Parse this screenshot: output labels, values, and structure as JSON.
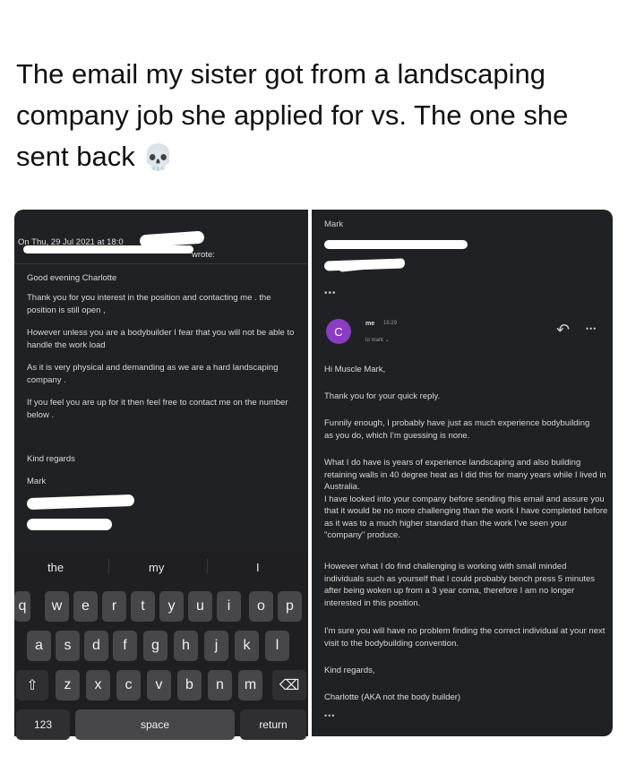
{
  "caption": {
    "text": "The email my sister got from a landscaping company job she applied for vs. The one she sent back",
    "emoji": "💀"
  },
  "left_email": {
    "header_date": "On Thu, 29 Jul 2021 at 18:0",
    "header_wrote": "wrote:",
    "greeting": "Good evening Charlotte",
    "paragraphs": [
      "Thank you for you interest in the position and contacting me . the position is still open ,",
      "However unless you are a bodybuilder I fear that you will not be able to handle the work load",
      "As it is very physical and demanding as we are a hard landscaping company .",
      "If you feel you are up for it then feel free to contact me on the number below ."
    ],
    "signoff": "Kind regards",
    "name": "Mark"
  },
  "keyboard": {
    "suggestions": [
      "the",
      "my",
      "I"
    ],
    "row1": [
      "q",
      "w",
      "e",
      "r",
      "t",
      "y",
      "u",
      "i",
      "o",
      "p"
    ],
    "row2": [
      "a",
      "s",
      "d",
      "f",
      "g",
      "h",
      "j",
      "k",
      "l"
    ],
    "row3": [
      "z",
      "x",
      "c",
      "v",
      "b",
      "n",
      "m"
    ],
    "shift_icon": "⇧",
    "delete_icon": "⌫",
    "numbers_key": "123",
    "space_key": "space",
    "return_key": "return"
  },
  "right_email": {
    "quoted_name": "Mark",
    "collapsed_dots": "•••",
    "avatar_letter": "C",
    "sender": "me",
    "time": "16:29",
    "to_line": "to mark ⌄",
    "reply_icon": "↶",
    "more_icon": "•••",
    "greeting": "Hi Muscle Mark,",
    "paragraphs": [
      "Thank you for your quick reply.",
      "Funnily enough, I probably have just as much experience bodybuilding as you do, which I'm guessing is none.",
      "What I do have is years of experience landscaping and also building retaining walls in 40 degree heat as I did this for many years while I lived in Australia.\nI have looked into your company before sending this email and assure you that it would be no more challenging than the work I have completed before as it was to a much higher standard than the work I've seen your \"company\" produce.",
      "However what I do find challenging is working with small minded individuals such as yourself that I could probably bench press 5 minutes after being woken up from a 3 year coma, therefore I am no longer interested in this position.",
      "I'm sure you will have no problem finding the correct individual at your next visit to the bodybuilding convention."
    ],
    "signoff": "Kind regards,",
    "signature": "Charlotte (AKA not the body builder)",
    "bottom_dots": "•••"
  }
}
